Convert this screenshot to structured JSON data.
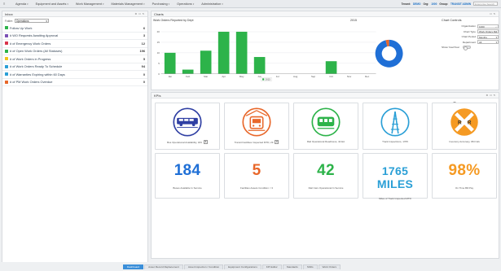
{
  "topbar": {
    "nav": [
      "Agenda",
      "Equipment and Assets",
      "Work Management",
      "Materials Management",
      "Purchasing",
      "Operations",
      "Administration"
    ],
    "tenant_label": "Tenant:",
    "tenant_value": "DEMO",
    "org_label": "Org:",
    "org_value": "1000",
    "group_label": "Group:",
    "group_value": "TRANSIT ADMIN",
    "search_placeholder": "Enterprise Search"
  },
  "inbox": {
    "title": "Inbox",
    "tools": "⚙ ⊡ ↻",
    "folder_label": "Folder:",
    "folder_value": "Operations",
    "items": [
      {
        "label": "Follow Up Work",
        "count": "6",
        "color": "#2db34a"
      },
      {
        "label": "# WO Requests Awaiting Approval",
        "count": "3",
        "color": "#7a4fb5"
      },
      {
        "label": "# of Emergency Work Orders",
        "count": "12",
        "color": "#d9334a"
      },
      {
        "label": "# of Open Work Orders (All Statuses)",
        "count": "196",
        "color": "#2db34a"
      },
      {
        "label": "# of Work Orders in Progress",
        "count": "5",
        "color": "#f2c31a"
      },
      {
        "label": "# of Work Orders Ready To Schedule",
        "count": "94",
        "color": "#2a9fd6"
      },
      {
        "label": "# of Warranties Expiring within 60 Days",
        "count": "0",
        "color": "#2a9fd6"
      },
      {
        "label": "# of PM Work Orders Overdue",
        "count": "0",
        "color": "#e8672a"
      }
    ]
  },
  "charts": {
    "title": "Charts",
    "tools": "⊡ ↻",
    "chart_heading": "Work Orders Reported by Dept",
    "year_label": "2015",
    "controls": {
      "title": "Chart Controls",
      "organization_label": "Organization",
      "organization_value": "1000",
      "chart_type_label": "Chart Type",
      "chart_type_value": "Work Orders Re",
      "chart_period_label": "Chart Period",
      "chart_period_value": "Months",
      "department_label": "Department",
      "department_value": "All",
      "show_year_label": "Show Year/Year"
    },
    "colors": {
      "bar": "#2db34a",
      "donut_main": "#1f6fd6",
      "donut_accent": "#e8672a"
    }
  },
  "chart_data": {
    "type": "bar",
    "title": "Work Orders Reported by Dept",
    "categories": [
      "Jan",
      "Feb",
      "Mar",
      "Apr",
      "May",
      "Jun",
      "Jul",
      "Aug",
      "Sep",
      "Oct",
      "Nov",
      "Dec"
    ],
    "series": [
      {
        "name": "2015",
        "values": [
          10,
          2,
          11,
          20,
          20,
          8,
          0,
          0,
          0,
          6,
          0,
          0
        ]
      }
    ],
    "ylim": [
      0,
      20
    ],
    "yticks": [
      0,
      5,
      10,
      15,
      20
    ],
    "legend": "bottom",
    "donut": [
      {
        "value": 0.96,
        "color": "#1f6fd6"
      },
      {
        "value": 0.04,
        "color": "#e8672a"
      }
    ]
  },
  "kpis": {
    "title": "KPIs",
    "tools": "⚙ ⊡ ↻",
    "resize_label": "Resize KPIs",
    "icon_cards": [
      {
        "caption": "Bus Operational Availability, 184",
        "icon": "bus-icon",
        "color": "#2f3fa3",
        "has_button": true
      },
      {
        "caption": "Transit Facilities Inspected MTD, 29",
        "icon": "facility-train-icon",
        "color": "#e8672a",
        "has_button": true
      },
      {
        "caption": "Rail Operational Readiness, 42 EA",
        "icon": "rail-car-icon",
        "color": "#2db34a",
        "has_button": false
      },
      {
        "caption": "Track Inspections, 1765",
        "icon": "track-icon",
        "color": "#2a9fd6",
        "has_button": false
      },
      {
        "caption": "Inventory Accuracy, 98.0 EA",
        "icon": "railroad-crossing-icon",
        "color": "#f59a23",
        "has_button": false
      }
    ],
    "number_cards": [
      {
        "value": "184",
        "caption": "Buses Available In Service",
        "color": "#1f6fd6"
      },
      {
        "value": "5",
        "caption": "Facilities Assets Condition < 3",
        "color": "#e8672a"
      },
      {
        "value": "42",
        "caption": "Rail Cars Operational In Service",
        "color": "#2db34a"
      },
      {
        "value": "1765 MILES",
        "caption": "Miles of Track Inspected MTD",
        "color": "#2a9fd6"
      },
      {
        "value": "98%",
        "caption": "On Time Bill Pay",
        "color": "#f59a23"
      }
    ]
  },
  "tabs": [
    "Dashboard",
    "Asset Record Replacement",
    "Asset Inspection / Condition",
    "Equipment Configurations",
    "KPI Editor",
    "Standards",
    "Shifts",
    "Work Orders"
  ]
}
